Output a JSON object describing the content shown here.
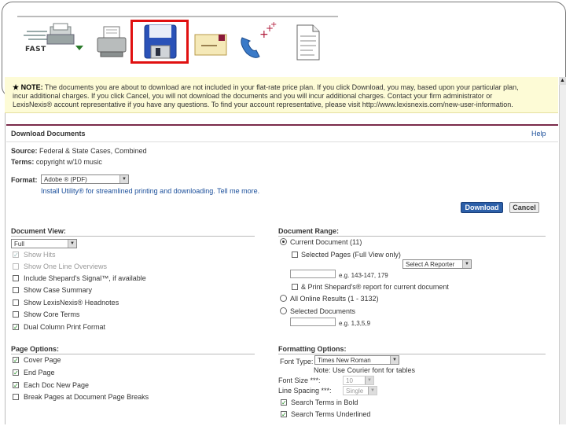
{
  "toolbar": {
    "fast_label": "FAST",
    "icons": [
      "fast-print-icon",
      "printer-icon",
      "floppy-disk-icon",
      "email-icon",
      "phone-icon",
      "document-icon"
    ]
  },
  "note": {
    "prefix": "★ NOTE:",
    "line1": "The documents you are about to download are not included in your flat-rate price plan. If you click Download, you may, based upon your particular plan,",
    "line2": "incur additional charges. If you click Cancel, you will not download the documents and you will incur additional charges. Contact your firm administrator or",
    "line3": "LexisNexis® account representative if you have any questions. To find your account representative, please visit http://www.lexisnexis.com/new-user-information."
  },
  "panel": {
    "title": "Download Documents",
    "help": "Help",
    "source_label": "Source:",
    "source_value": "Federal & State Cases, Combined",
    "terms_label": "Terms:",
    "terms_value": "copyright w/10 music",
    "format_label": "Format:",
    "format_value": "Adobe ® (PDF)",
    "install_text": "Install Utility® for streamlined printing and downloading.",
    "tell_me_more": "Tell me more.",
    "download_button": "Download",
    "cancel_button": "Cancel"
  },
  "document_view": {
    "title": "Document View:",
    "view_value": "Full",
    "options": [
      {
        "label": "Show Hits",
        "checked": true,
        "disabled": true
      },
      {
        "label": "Show One Line Overviews",
        "checked": false,
        "disabled": true
      },
      {
        "label": "Include Shepard's Signal™, if available",
        "checked": false,
        "disabled": false
      },
      {
        "label": "Show Case Summary",
        "checked": false,
        "disabled": false
      },
      {
        "label": "Show LexisNexis® Headnotes",
        "checked": false,
        "disabled": false
      },
      {
        "label": "Show Core Terms",
        "checked": false,
        "disabled": false
      },
      {
        "label": "Dual Column Print Format",
        "checked": true,
        "disabled": false
      }
    ]
  },
  "document_range": {
    "title": "Document Range:",
    "current": "Current Document (11)",
    "selected_pages": "Selected Pages (Full View only)",
    "reporter_select": "Select A Reporter",
    "pages_hint": "e.g. 143-147, 179",
    "print_shepard": "& Print Shepard's® report for current document",
    "all_results": "All Online Results (1 - 3132)",
    "selected_docs": "Selected Documents",
    "docs_hint": "e.g. 1,3,5,9"
  },
  "page_options": {
    "title": "Page Options:",
    "options": [
      {
        "label": "Cover Page",
        "checked": true
      },
      {
        "label": "End Page",
        "checked": true
      },
      {
        "label": "Each Doc New Page",
        "checked": true
      },
      {
        "label": "Break Pages at Document Page Breaks",
        "checked": false
      }
    ]
  },
  "formatting": {
    "title": "Formatting Options:",
    "font_type_label": "Font Type:",
    "font_type_value": "Times New Roman",
    "font_note": "Note: Use Courier font for tables",
    "font_size_label": "Font Size ***:",
    "font_size_value": "10",
    "line_spacing_label": "Line Spacing ***:",
    "line_spacing_value": "Single",
    "search_bold": "Search Terms in Bold",
    "search_underline": "Search Terms Underlined"
  },
  "colors": {
    "selection_red": "#e01010",
    "accent_maroon": "#7a2a4a",
    "link_blue": "#1a4e9a",
    "note_bg": "#fdfbd6"
  }
}
